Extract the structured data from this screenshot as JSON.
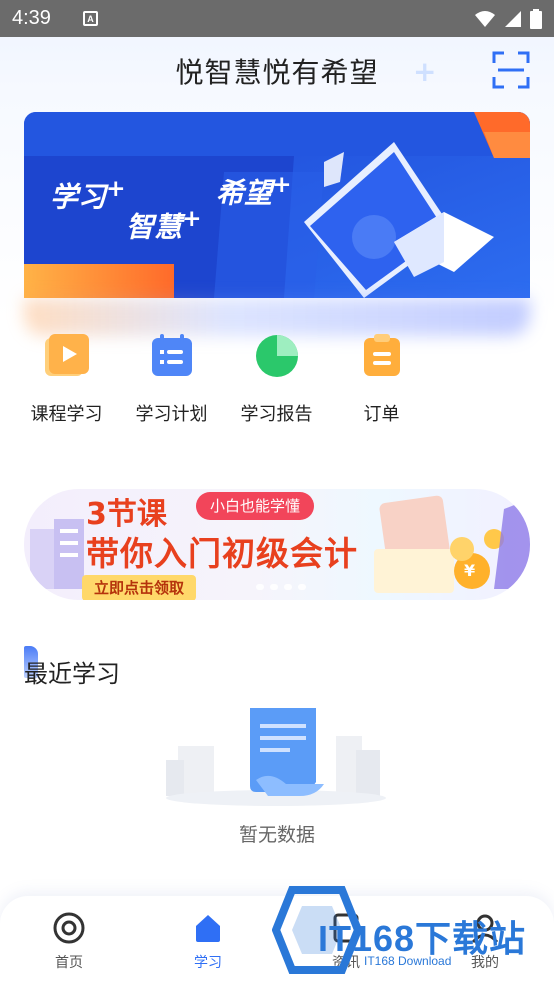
{
  "status_bar": {
    "time": "4:39",
    "notification_letter": "A"
  },
  "header": {
    "title": "悦智慧悦有希望"
  },
  "banner": {
    "text_learning": "学习",
    "text_wisdom": "智慧",
    "text_hope": "希望",
    "plus": "+"
  },
  "quick_actions": [
    {
      "label": "课程学习",
      "icon": "video-play-icon",
      "color": "#ffb24a"
    },
    {
      "label": "学习计划",
      "icon": "calendar-list-icon",
      "color": "#4f86f7"
    },
    {
      "label": "学习报告",
      "icon": "pie-chart-icon",
      "color": "#2bc86b"
    },
    {
      "label": "订单",
      "icon": "clipboard-icon",
      "color": "#ffae3c"
    }
  ],
  "promo": {
    "title_line1": "3节课",
    "title_line2": "带你入门初级会计",
    "tag": "小白也能学懂",
    "cta": "立即点击领取",
    "currency_symbol": "¥"
  },
  "recent": {
    "title": "最近学习",
    "empty_text": "暂无数据"
  },
  "bottom_nav": {
    "items": [
      {
        "label": "首页",
        "icon": "home-circle-icon",
        "active": false
      },
      {
        "label": "学习",
        "icon": "learn-house-icon",
        "active": true
      },
      {
        "label": "资讯",
        "icon": "news-icon",
        "active": false
      },
      {
        "label": "我的",
        "icon": "profile-icon",
        "active": false
      }
    ]
  },
  "watermark": {
    "brand": "IT168下载站",
    "subtitle": "IT168 Download"
  },
  "colors": {
    "accent": "#2f6ff5",
    "banner_blue": "#1f4fd8",
    "promo_red": "#e8401e"
  }
}
